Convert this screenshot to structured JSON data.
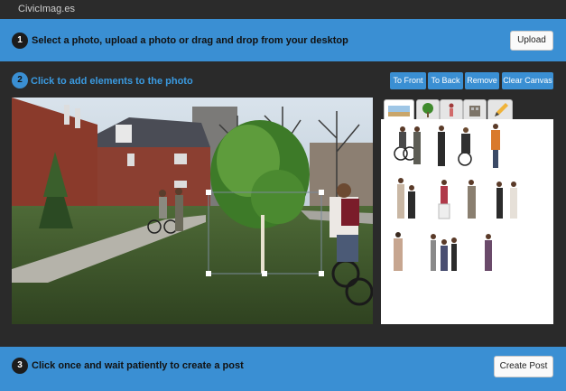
{
  "app": {
    "title": "CivicImag.es"
  },
  "step1": {
    "number": "1",
    "text": "Select a photo, upload a photo or drag and drop from your desktop",
    "button": "Upload"
  },
  "step2": {
    "number": "2",
    "text": "Click to add elements to the photo",
    "toolbar": [
      "To Front",
      "To Back",
      "Remove",
      "Clear Canvas"
    ]
  },
  "library": {
    "tabs": [
      {
        "icon": "photo-icon",
        "active": true
      },
      {
        "icon": "tree-icon",
        "active": false
      },
      {
        "icon": "person-icon",
        "active": false
      },
      {
        "icon": "building-icon",
        "active": false
      },
      {
        "icon": "pencil-icon",
        "active": false
      }
    ],
    "people_count": 16
  },
  "step3": {
    "number": "3",
    "text": "Click once and wait patiently to create a post",
    "button": "Create Post"
  },
  "colors": {
    "accent": "#3a8fd3",
    "dark": "#2a2a2a",
    "link_text": "#3a9ae0"
  }
}
